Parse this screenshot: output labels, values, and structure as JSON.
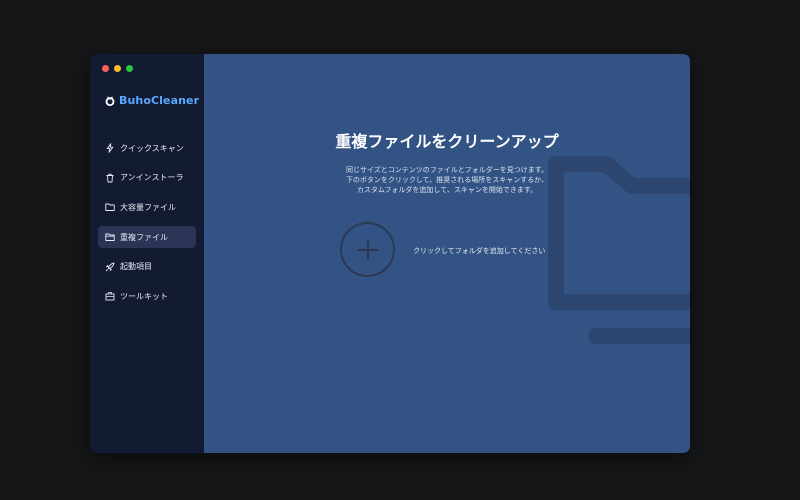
{
  "app": {
    "name": "BuhoCleaner"
  },
  "sidebar": {
    "items": [
      {
        "label": "クイックスキャン",
        "icon": "lightning-icon",
        "active": false
      },
      {
        "label": "アンインストーラ",
        "icon": "trash-icon",
        "active": false
      },
      {
        "label": "大容量ファイル",
        "icon": "folder-icon",
        "active": false
      },
      {
        "label": "重複ファイル",
        "icon": "duplicate-folder-icon",
        "active": true
      },
      {
        "label": "起動項目",
        "icon": "rocket-icon",
        "active": false
      },
      {
        "label": "ツールキット",
        "icon": "toolbox-icon",
        "active": false
      }
    ]
  },
  "main": {
    "title": "重複ファイルをクリーンアップ",
    "description": [
      "同じサイズとコンテンツのファイルとフォルダーを見つけます。",
      "下のボタンをクリックして、推奨される場所をスキャンするか、",
      "カスタムフォルダを追加して、スキャンを開始できます。"
    ],
    "add_folder_hint": "クリックしてフォルダを追加してください"
  },
  "colors": {
    "sidebar_bg": "#131b33",
    "main_bg": "#335384",
    "brand_accent": "#5aa8ff",
    "active_item_bg": "#2a3455"
  }
}
